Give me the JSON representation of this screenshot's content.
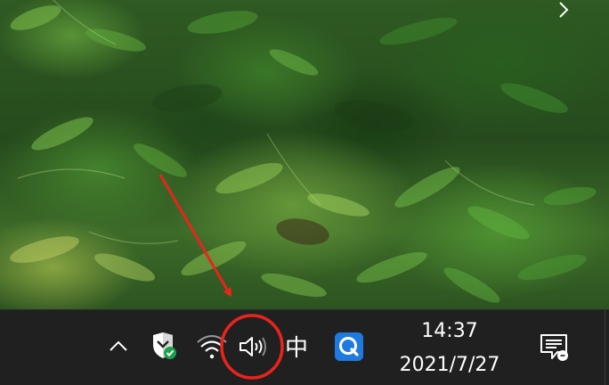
{
  "desktop": {
    "next_wallpaper_glyph": ">"
  },
  "taskbar": {
    "overflow_icon": "chevron-up-icon",
    "security_icon": "shield-check-icon",
    "network_icon": "wifi-icon",
    "volume_icon": "speaker-volume-icon",
    "ime_label": "中",
    "app_icon": "q-app-icon",
    "clock": {
      "time": "14:37",
      "date": "2021/7/27"
    },
    "notification_icon": "action-center-icon"
  },
  "annotation": {
    "color": "#e8241c",
    "arrow_target": "volume-icon",
    "circle_target": "volume-icon"
  },
  "colors": {
    "taskbar_bg": "#202020",
    "security_green": "#1aa34a",
    "q_app_blue": "#1f7ae0"
  }
}
